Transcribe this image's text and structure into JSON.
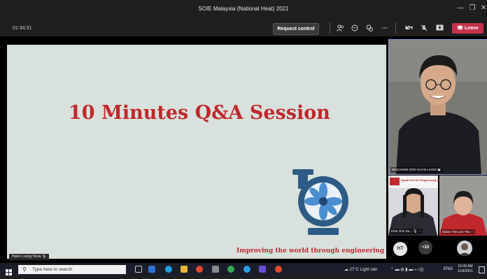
{
  "window": {
    "title": "SOIE Malaysia (National Heat) 2021",
    "controls": [
      "—",
      "❐",
      "✕"
    ]
  },
  "toolbar": {
    "timer": "01:34:31",
    "request_control": "Request control",
    "leave": "Leave",
    "icons": [
      "people-icon",
      "chat-icon",
      "reactions-icon",
      "more-icon",
      "camera-off-icon",
      "mic-off-icon",
      "share-icon"
    ]
  },
  "slide": {
    "title": "10 Minutes Q&A Session",
    "footer": "Improving the world through engineering",
    "presenter": "Hsien Loong Yeow",
    "accent_color": "#c0282d",
    "background_color": "#d9e1dc"
  },
  "participants": {
    "main": {
      "name": "BENJAMIN ONG KUAN LIANG"
    },
    "small": [
      {
        "name": "Khoi Yinn Se...",
        "banner": "Speak Out for Engineering (S"
      },
      {
        "name": "Elaine Yee Lee Yeu"
      }
    ],
    "initials": "HT",
    "overflow_count": "+33"
  },
  "taskbar": {
    "search_placeholder": "Type here to search",
    "weather": "27°C  Light rain",
    "language": "ENG",
    "time": "10:40 AM",
    "date": "11/8/2021"
  }
}
